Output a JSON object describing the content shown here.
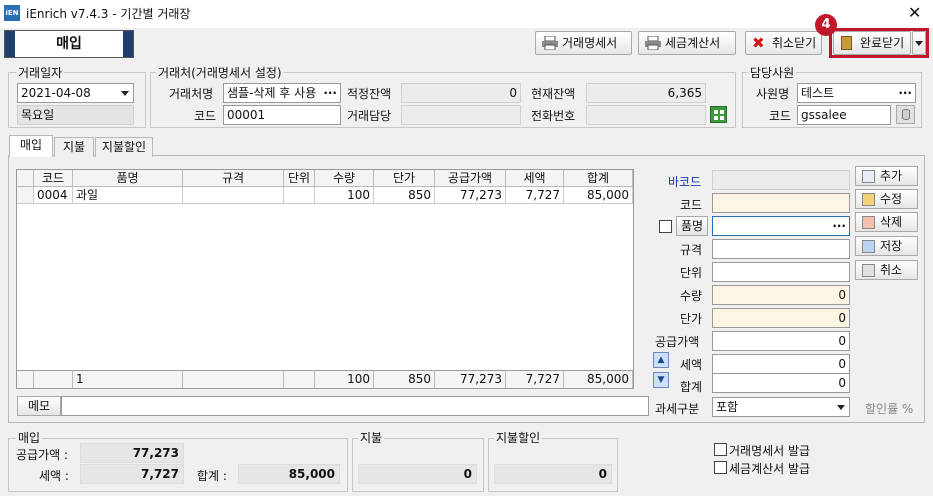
{
  "window": {
    "icon_text": "iEN",
    "title": "iEnrich v7.4.3 - 기간별 거래장",
    "close": "✕"
  },
  "panel_title": "매입",
  "toolbar": {
    "statement_label": "거래명세서",
    "tax_invoice_label": "세금계산서",
    "cancel_close_label": "취소닫기",
    "complete_close_label": "완료닫기",
    "badge": "4"
  },
  "trade_date": {
    "section": "거래일자",
    "value": "2021-04-08",
    "weekday": "목요일"
  },
  "partner": {
    "section": "거래처(거래명세서 설정)",
    "name_label": "거래처명",
    "name_value": "샘플-삭제 후 사용",
    "more": "···",
    "code_label": "코드",
    "code_value": "00001",
    "proper_balance_label": "적정잔액",
    "proper_balance_value": "0",
    "current_balance_label": "현재잔액",
    "current_balance_value": "6,365",
    "manager_label": "거래담당",
    "manager_value": "",
    "phone_label": "전화번호",
    "phone_value": ""
  },
  "staff": {
    "section": "담당사원",
    "name_label": "사원명",
    "name_value": "테스트",
    "more": "···",
    "code_label": "코드",
    "code_value": "gssalee"
  },
  "tabs": [
    "매입",
    "지불",
    "지불할인"
  ],
  "grid": {
    "columns": [
      "코드",
      "품명",
      "규격",
      "단위",
      "수량",
      "단가",
      "공급가액",
      "세액",
      "합계"
    ],
    "rows": [
      [
        "0004",
        "과일",
        "",
        "",
        "100",
        "850",
        "77,273",
        "7,727",
        "85,000"
      ]
    ],
    "footer": [
      "1",
      "",
      "",
      "100",
      "850",
      "77,273",
      "7,727",
      "85,000"
    ]
  },
  "detail": {
    "barcode_label": "바코드",
    "code_label": "코드",
    "item_label": "품명",
    "spec_label": "규격",
    "unit_label": "단위",
    "qty_label": "수량",
    "price_label": "단가",
    "supply_label": "공급가액",
    "tax_label": "세액",
    "total_label": "합계",
    "more": "···",
    "qty_value": "0",
    "price_value": "0",
    "supply_value": "0",
    "tax_value": "0",
    "total_value": "0",
    "tax_type_label": "과세구분",
    "tax_type_value": "포함",
    "discount_rate_label": "할인률 %"
  },
  "side_buttons": {
    "add": "추가",
    "edit": "수정",
    "delete": "삭제",
    "save": "저장",
    "cancel": "취소"
  },
  "memo_label": "메모",
  "summary": {
    "purchase_section": "매입",
    "supply_label": "공급가액 :",
    "supply_value": "77,273",
    "tax_label": "세액 :",
    "tax_value": "7,727",
    "total_label": "합계 :",
    "total_value": "85,000",
    "payment_section": "지불",
    "payment_value": "0",
    "pay_discount_section": "지불할인",
    "pay_discount_value": "0",
    "issue_statement_label": "거래명세서 발급",
    "issue_tax_invoice_label": "세금계산서 발급"
  }
}
